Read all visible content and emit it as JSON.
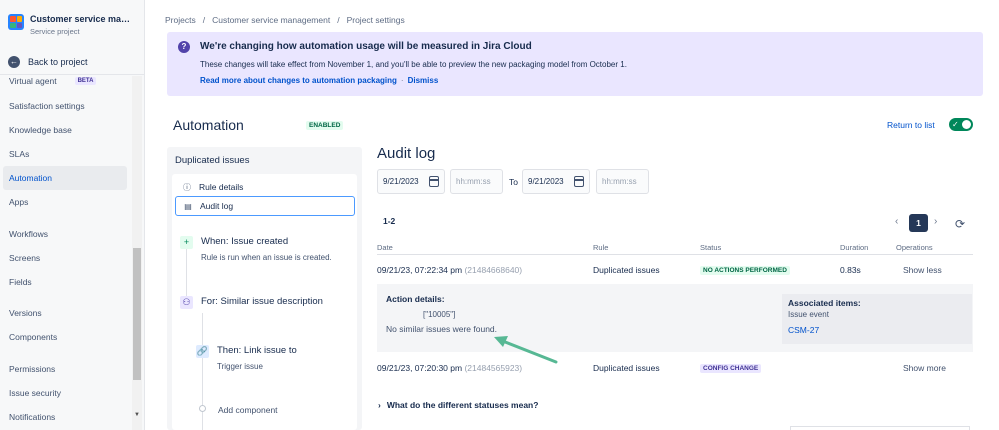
{
  "project": {
    "name": "Customer service manag...",
    "type": "Service project",
    "back_label": "Back to project"
  },
  "sidebar": {
    "items": [
      {
        "label": "Virtual agent",
        "badge": "BETA"
      },
      {
        "label": "Satisfaction settings"
      },
      {
        "label": "Knowledge base"
      },
      {
        "label": "SLAs"
      },
      {
        "label": "Automation"
      },
      {
        "label": "Apps"
      },
      {
        "label": "Workflows"
      },
      {
        "label": "Screens"
      },
      {
        "label": "Fields"
      },
      {
        "label": "Versions"
      },
      {
        "label": "Components"
      },
      {
        "label": "Permissions"
      },
      {
        "label": "Issue security"
      },
      {
        "label": "Notifications"
      }
    ]
  },
  "breadcrumb": [
    "Projects",
    "/",
    "Customer service management",
    "/",
    "Project settings"
  ],
  "banner": {
    "title": "We're changing how automation usage will be measured in Jira Cloud",
    "text": "These changes will take effect from November 1, and you'll be able to preview the new packaging model from October 1.",
    "link_read_more": "Read more about changes to automation packaging",
    "separator": "·",
    "link_dismiss": "Dismiss"
  },
  "automation": {
    "title": "Automation",
    "status_badge": "ENABLED",
    "return_label": "Return to list"
  },
  "rule": {
    "name": "Duplicated issues",
    "nav": [
      "Rule details",
      "Audit log"
    ],
    "components": [
      {
        "title": "When: Issue created",
        "subtitle": "Rule is run when an issue is created."
      },
      {
        "title": "For: Similar issue description",
        "subtitle": ""
      },
      {
        "title": "Then: Link issue to",
        "subtitle": "Trigger issue"
      }
    ],
    "add_component": "Add component"
  },
  "audit": {
    "title": "Audit log",
    "from_date": "9/21/2023",
    "from_time_placeholder": "hh:mm:ss",
    "to_label": "To",
    "to_date": "9/21/2023",
    "to_time_placeholder": "hh:mm:ss",
    "count": "1-2",
    "pager": {
      "prev": "‹",
      "current": "1",
      "next": "›"
    },
    "columns": [
      "Date",
      "Rule",
      "Status",
      "Duration",
      "Operations"
    ],
    "rows": [
      {
        "date": "09/21/23, 07:22:34 pm",
        "id": "(21484668640)",
        "rule": "Duplicated issues",
        "status": "NO ACTIONS PERFORMED",
        "duration": "0.83s",
        "operation": "Show less"
      },
      {
        "date": "09/21/23, 07:20:30 pm",
        "id": "(21484565923)",
        "rule": "Duplicated issues",
        "status": "CONFIG CHANGE",
        "duration": "",
        "operation": "Show more"
      }
    ],
    "details": {
      "title": "Action details:",
      "json": "[\"10005\"]",
      "message": "No similar issues were found.",
      "assoc_title": "Associated items:",
      "assoc_type": "Issue event",
      "assoc_link": "CSM-27"
    },
    "statuses_toggle": "What do the different statuses mean?"
  },
  "colors": {
    "accent": "#0052cc",
    "banner_bg": "#eae6ff",
    "success": "#00875a",
    "arrow": "#57b894"
  }
}
